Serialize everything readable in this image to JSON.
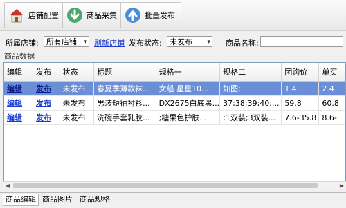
{
  "toolbar": {
    "store_config": "店铺配置",
    "product_collect": "商品采集",
    "batch_publish": "批量发布"
  },
  "filter": {
    "store_label": "所属店铺:",
    "store_value": "所有店铺",
    "refresh_link": "刷新店铺",
    "status_label": "发布状态:",
    "status_value": "未发布",
    "product_name_label": "商品名称:",
    "product_name_value": ""
  },
  "panel": {
    "title": "商品数据"
  },
  "table": {
    "headers": [
      "编辑",
      "发布",
      "状态",
      "标题",
      "规格一",
      "规格二",
      "团购价",
      "单买"
    ],
    "rows": [
      [
        "编辑",
        "发布",
        "未发布",
        "春夏季薄款袜...",
        "女船 星星10...",
        "如图;",
        "1.4",
        "2.4"
      ],
      [
        "编辑",
        "发布",
        "未发布",
        "男装短袖衬衫...",
        "DX2675白底黑...",
        "37;38;39;40;...",
        "59.8",
        "60.8"
      ],
      [
        "编辑",
        "发布",
        "未发布",
        "洗碗手套乳胶...",
        ";糖果色护肤...",
        ";1双装;3双装...",
        "7.6-35.8",
        "8.6-"
      ]
    ],
    "selected_row": 0
  },
  "tabs": [
    "商品编辑",
    "商品图片",
    "商品规格"
  ],
  "active_tab": 0,
  "colors": {
    "selection": "#6b8fd6",
    "link": "#1a3cd0",
    "house_icon": "#c0392b",
    "arrow_icon": "#4aa86c",
    "upload_icon": "#4a8fd6"
  }
}
